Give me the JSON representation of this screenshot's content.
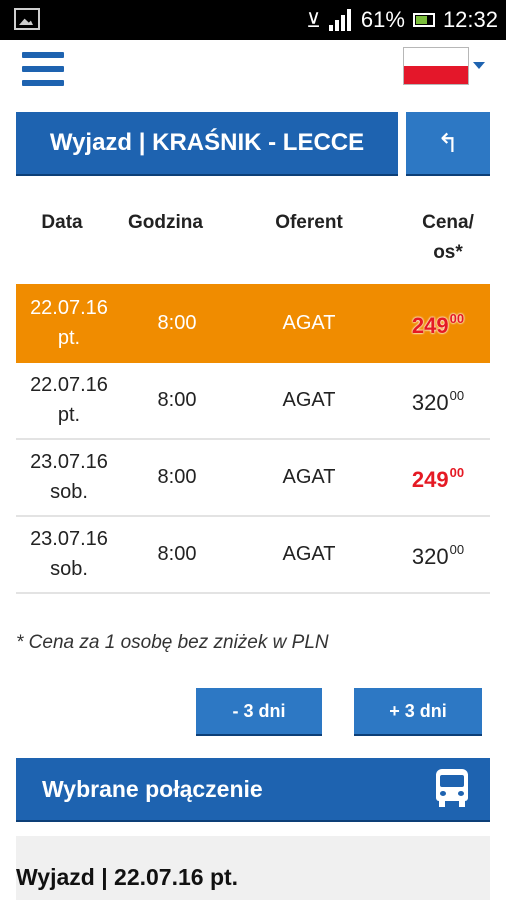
{
  "status_bar": {
    "battery": "61%",
    "time": "12:32",
    "icons": [
      "gallery-icon",
      "vibrate-icon",
      "signal-icon",
      "battery-icon"
    ]
  },
  "header": {
    "menu_icon": "hamburger-icon",
    "language_flag": "poland-flag"
  },
  "route": {
    "title": "Wyjazd | KRAŚNIK - LECCE",
    "back_icon": "reply-arrow-icon"
  },
  "table": {
    "headers": {
      "date": "Data",
      "time": "Godzina",
      "operator": "Oferent",
      "price_line1": "Cena/",
      "price_line2": "os*"
    },
    "rows": [
      {
        "date": "22.07.16",
        "day": "pt.",
        "time": "8:00",
        "operator": "AGAT",
        "price": "249",
        "cents": "00",
        "promo": true,
        "selected": true
      },
      {
        "date": "22.07.16",
        "day": "pt.",
        "time": "8:00",
        "operator": "AGAT",
        "price": "320",
        "cents": "00",
        "promo": false,
        "selected": false
      },
      {
        "date": "23.07.16",
        "day": "sob.",
        "time": "8:00",
        "operator": "AGAT",
        "price": "249",
        "cents": "00",
        "promo": true,
        "selected": false
      },
      {
        "date": "23.07.16",
        "day": "sob.",
        "time": "8:00",
        "operator": "AGAT",
        "price": "320",
        "cents": "00",
        "promo": false,
        "selected": false
      }
    ]
  },
  "note": "* Cena za 1 osobę bez zniżek w PLN",
  "day_buttons": {
    "minus": "- 3 dni",
    "plus": "+ 3 dni"
  },
  "selected_connection": {
    "label": "Wybrane połączenie",
    "icon": "bus-icon"
  },
  "detail": {
    "title": "Wyjazd | 22.07.16 pt."
  },
  "colors": {
    "primary": "#1e63b0",
    "highlight": "#f08c00",
    "promo_price": "#e51a24"
  }
}
